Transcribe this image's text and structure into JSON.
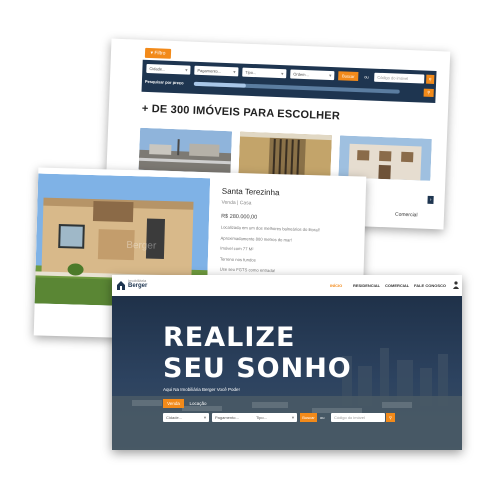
{
  "colors": {
    "accent": "#f28a1a",
    "navy": "#1e3550",
    "hero": "#1a2b3f"
  },
  "listing_page": {
    "filter_tab": "Filtro",
    "selects": [
      "Cidade...",
      "Pagamento...",
      "Tipo...",
      "Ordem..."
    ],
    "search_button": "Buscar",
    "or": "ou",
    "code_placeholder": "Código do imóvel",
    "price_label": "Pesquisar por preço",
    "price_range_fill": 0.25,
    "heading": "+ DE 300 IMÓVEIS PARA ESCOLHER",
    "card_caption": "Comercial"
  },
  "detail_page": {
    "title": "Santa Terezinha",
    "subtitle": "Venda | Casa",
    "price": "R$ 280.000,00",
    "lines": [
      "Localizada em um dos melhores balneários do litoral!",
      "Aproximadamente 800 metros do mar!",
      "Imóvel com 77 M²",
      "Terreno nos fundos",
      "Use seu FGTS como entrada!"
    ]
  },
  "home_page": {
    "logo_small": "Imobiliária",
    "logo_name": "Berger",
    "nav": [
      "INÍCIO",
      "RESIDENCIAL",
      "COMERCIAL",
      "FALE CONOSCO"
    ],
    "headline_1": "REALIZE",
    "headline_2": "SEU SONHO",
    "tagline": "Aqui Na Imobiliária Berger Você Pode!",
    "tabs": [
      "Venda",
      "Locação"
    ],
    "selects": [
      "Cidade...",
      "Pagamento...",
      "Tipo..."
    ],
    "search_button": "Buscar",
    "or": "ou",
    "code_placeholder": "Código do imóvel"
  }
}
